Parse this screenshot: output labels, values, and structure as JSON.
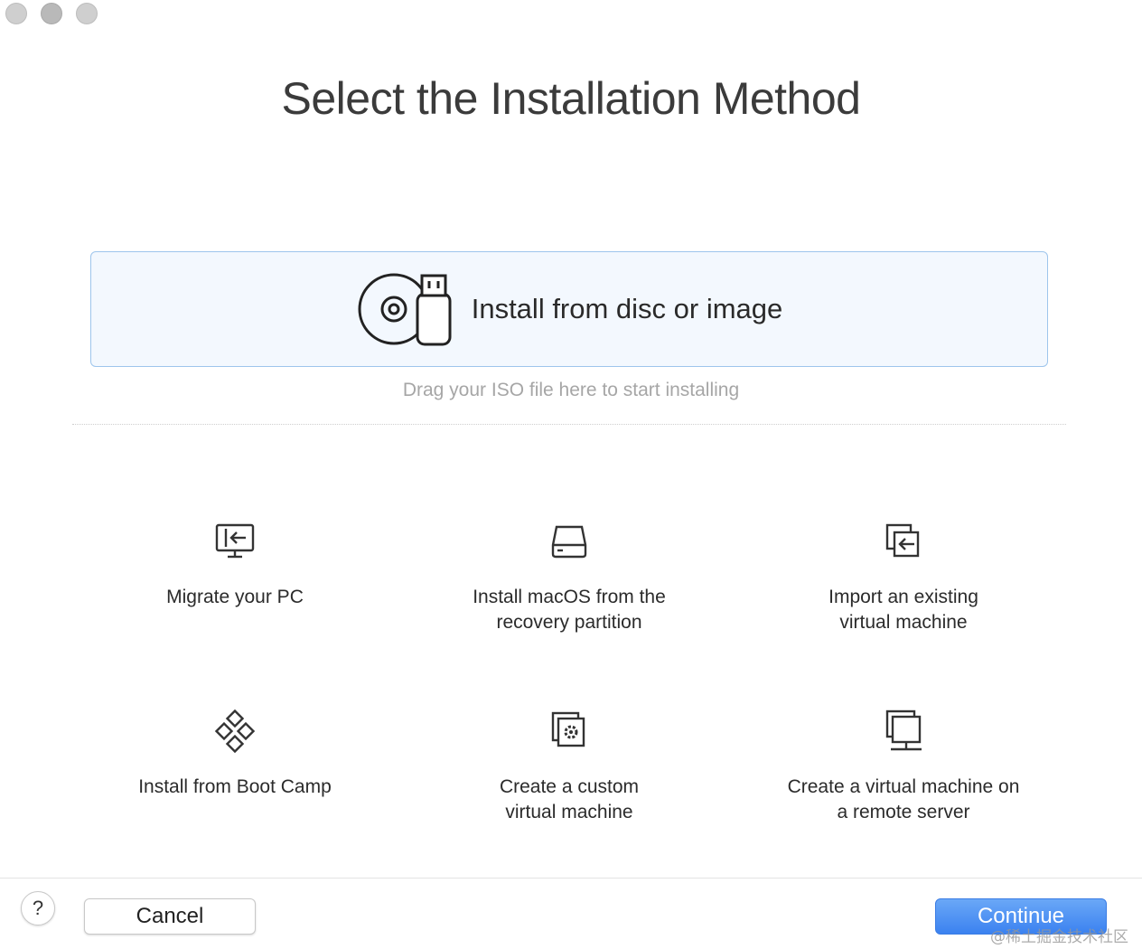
{
  "window": {
    "title": "Select the Installation Method"
  },
  "drop_card": {
    "label": "Install from disc or image",
    "hint": "Drag your ISO file here to start installing",
    "icon": "disc-usb-icon"
  },
  "options": [
    {
      "label": "Migrate your PC",
      "icon": "monitor-import-icon"
    },
    {
      "label": "Install macOS from the\nrecovery partition",
      "icon": "hard-drive-icon"
    },
    {
      "label": "Import an existing\nvirtual machine",
      "icon": "import-window-icon"
    },
    {
      "label": "Install from Boot Camp",
      "icon": "bootcamp-diamond-icon"
    },
    {
      "label": "Create a custom\nvirtual machine",
      "icon": "gear-window-icon"
    },
    {
      "label": "Create a virtual machine on\na remote server",
      "icon": "remote-monitor-icon"
    }
  ],
  "footer": {
    "help_label": "?",
    "cancel_label": "Cancel",
    "continue_label": "Continue"
  },
  "watermark": "@稀土掘金技术社区",
  "colors": {
    "accent": "#3b82f0",
    "card_border": "#9ec5ec",
    "card_bg": "#f3f8fe",
    "hint": "#a6a6a6"
  }
}
